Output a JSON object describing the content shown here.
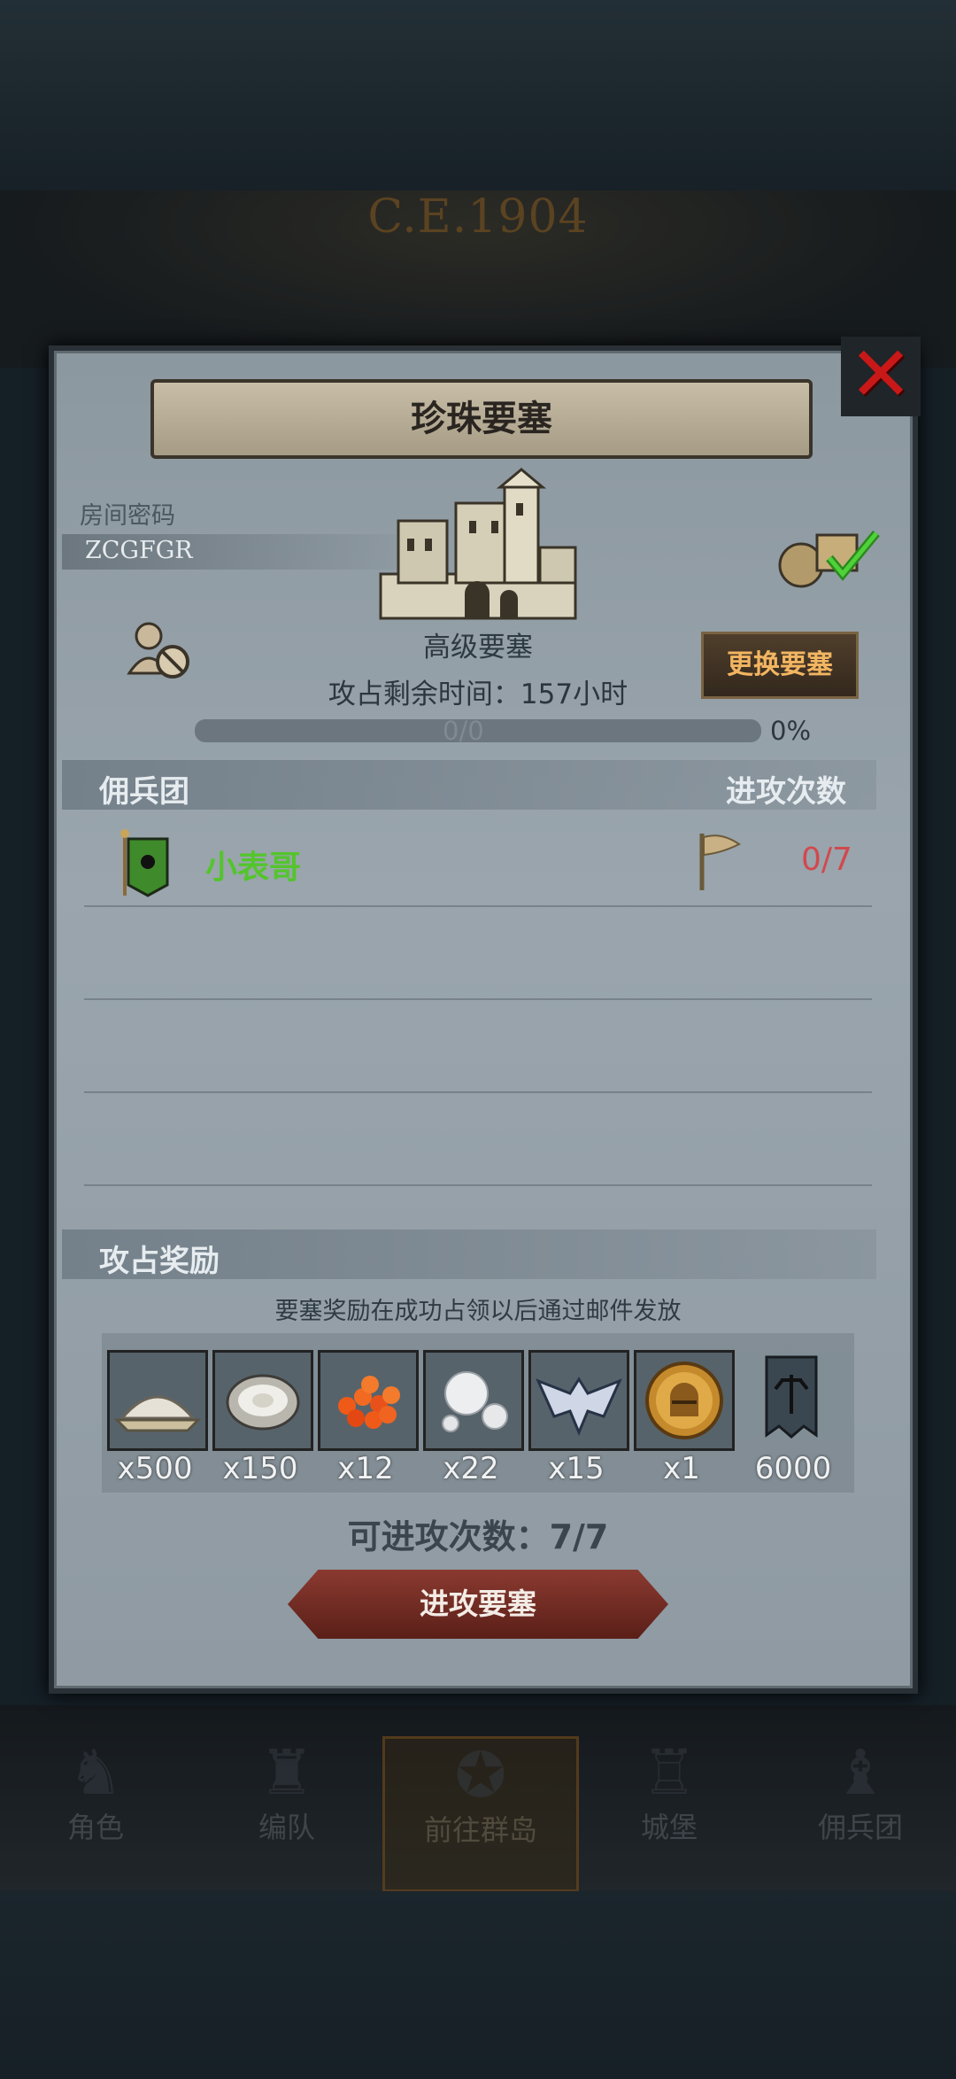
{
  "background": {
    "era_text": "C.E.1904"
  },
  "tabs": [
    {
      "label": "角色"
    },
    {
      "label": "编队"
    },
    {
      "label": "前往群岛"
    },
    {
      "label": "城堡"
    },
    {
      "label": "佣兵团"
    }
  ],
  "dialog": {
    "title": "珍珠要塞",
    "room_password_label": "房间密码",
    "room_code": "ZCGFGR",
    "fortress_level": "高级要塞",
    "timer_text": "攻占剩余时间：157小时",
    "progress_text": "0/0",
    "progress_percent": "0%",
    "change_button": "更换要塞",
    "mercenary_header": "佣兵团",
    "attack_times_header": "进攻次数",
    "guild": {
      "name": "小表哥",
      "attacks": "0/7"
    },
    "rewards_header": "攻占奖励",
    "rewards_note": "要塞奖励在成功占领以后通过邮件发放",
    "rewards": [
      {
        "icon": "salt-pile-icon",
        "qty": "x500"
      },
      {
        "icon": "oyster-icon",
        "qty": "x150"
      },
      {
        "icon": "fish-roe-icon",
        "qty": "x12"
      },
      {
        "icon": "pearls-icon",
        "qty": "x22"
      },
      {
        "icon": "winged-emblem-icon",
        "qty": "x15"
      },
      {
        "icon": "knight-helmet-coin-icon",
        "qty": "x1"
      },
      {
        "icon": "guild-banner-icon",
        "qty": "6000"
      }
    ],
    "available_attacks": "可进攻次数：7/7",
    "attack_button": "进攻要塞"
  },
  "colors": {
    "guild_name": "#53c52c",
    "attack_count": "#d1494e",
    "close_x": "#c81818",
    "change_button_text": "#f2b561"
  }
}
